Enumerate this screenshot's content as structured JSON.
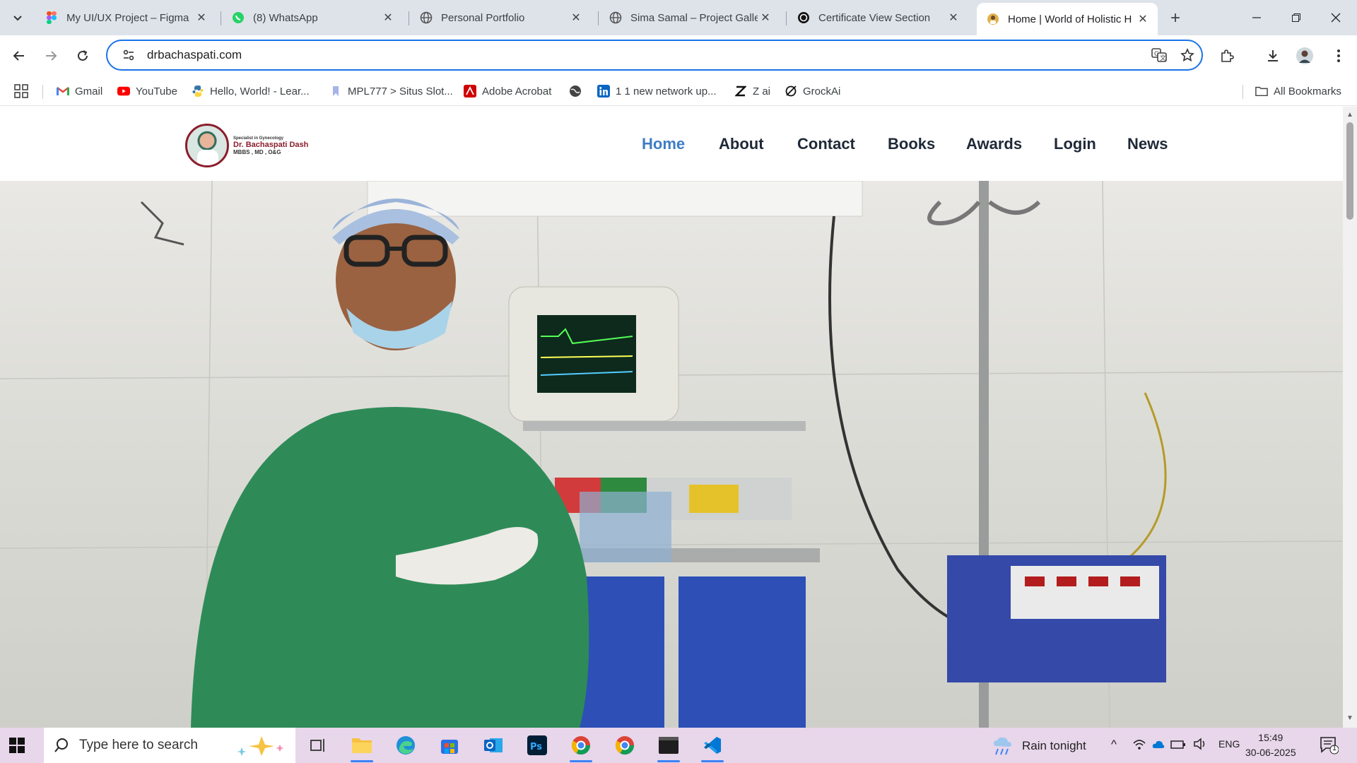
{
  "colors": {
    "accent": "#1a73e8",
    "nav_active": "#3f7dc4",
    "brand": "#8b1d2c"
  },
  "browser": {
    "tabs": [
      {
        "title": "My UI/UX Project – Figma",
        "icon": "figma-icon"
      },
      {
        "title": "(8) WhatsApp",
        "icon": "whatsapp-icon"
      },
      {
        "title": "Personal Portfolio",
        "icon": "globe-icon"
      },
      {
        "title": "Sima Samal – Project Galle",
        "icon": "globe-icon"
      },
      {
        "title": "Certificate View Section",
        "icon": "openai-icon"
      },
      {
        "title": "Home | World of Holistic H",
        "icon": "site-icon",
        "active": true
      }
    ],
    "url": "drbachaspati.com",
    "bookmarks": [
      {
        "label": "Gmail",
        "icon": "gmail-icon"
      },
      {
        "label": "YouTube",
        "icon": "youtube-icon"
      },
      {
        "label": "Hello, World! - Lear...",
        "icon": "python-icon"
      },
      {
        "label": "MPL777 > Situs Slot...",
        "icon": "bookmark-icon"
      },
      {
        "label": "Adobe Acrobat",
        "icon": "acrobat-icon"
      },
      {
        "label": "",
        "icon": "globe-icon"
      },
      {
        "label": "1 1 new network up...",
        "icon": "linkedin-icon"
      },
      {
        "label": "Z ai",
        "icon": "z-icon"
      },
      {
        "label": "GrockAi",
        "icon": "grok-icon"
      }
    ],
    "all_bookmarks": "All Bookmarks"
  },
  "site": {
    "logo": {
      "small": "Specialist in Gynecology",
      "name": "Dr. Bachaspati Dash",
      "degrees": "MBBS , MD , O&G"
    },
    "nav": [
      {
        "label": "Home",
        "active": true
      },
      {
        "label": "About"
      },
      {
        "label": "Contact"
      },
      {
        "label": "Books"
      },
      {
        "label": "Awards"
      },
      {
        "label": "Login"
      },
      {
        "label": "News"
      }
    ]
  },
  "taskbar": {
    "search_placeholder": "Type here to search",
    "weather": "Rain tonight",
    "lang": "ENG",
    "time": "15:49",
    "date": "30-06-2025",
    "notifications": "1"
  }
}
